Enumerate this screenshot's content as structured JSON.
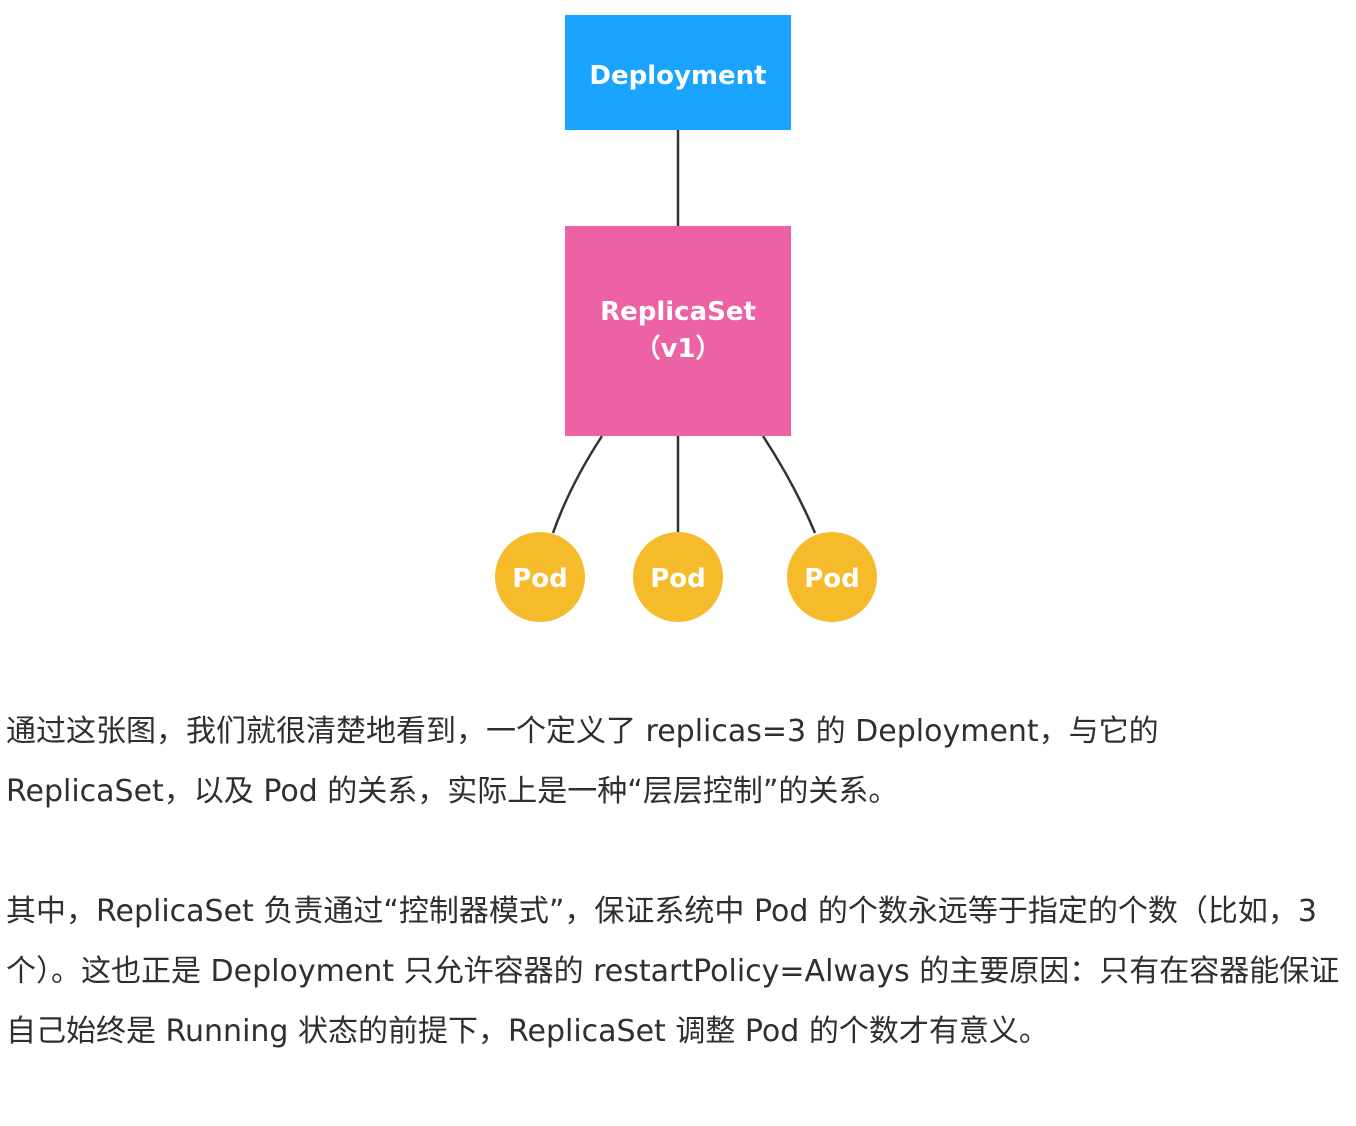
{
  "diagram": {
    "deployment": {
      "label": "Deployment",
      "color": "#1aa3ff"
    },
    "replicaset": {
      "label_line1": "ReplicaSet",
      "label_line2": "（v1）",
      "color": "#ec62a5"
    },
    "pods": [
      {
        "label": "Pod"
      },
      {
        "label": "Pod"
      },
      {
        "label": "Pod"
      }
    ],
    "pod_color": "#f5bb2a",
    "edge_color": "#333333"
  },
  "article": {
    "paragraphs": [
      "通过这张图，我们就很清楚地看到，一个定义了 replicas=3 的 Deployment，与它的 ReplicaSet，以及 Pod 的关系，实际上是一种“层层控制”的关系。",
      "其中，ReplicaSet 负责通过“控制器模式”，保证系统中 Pod 的个数永远等于指定的个数（比如，3 个）。这也正是 Deployment 只允许容器的 restartPolicy=Always 的主要原因：只有在容器能保证自己始终是 Running 状态的前提下，ReplicaSet 调整 Pod 的个数才有意义。"
    ]
  }
}
